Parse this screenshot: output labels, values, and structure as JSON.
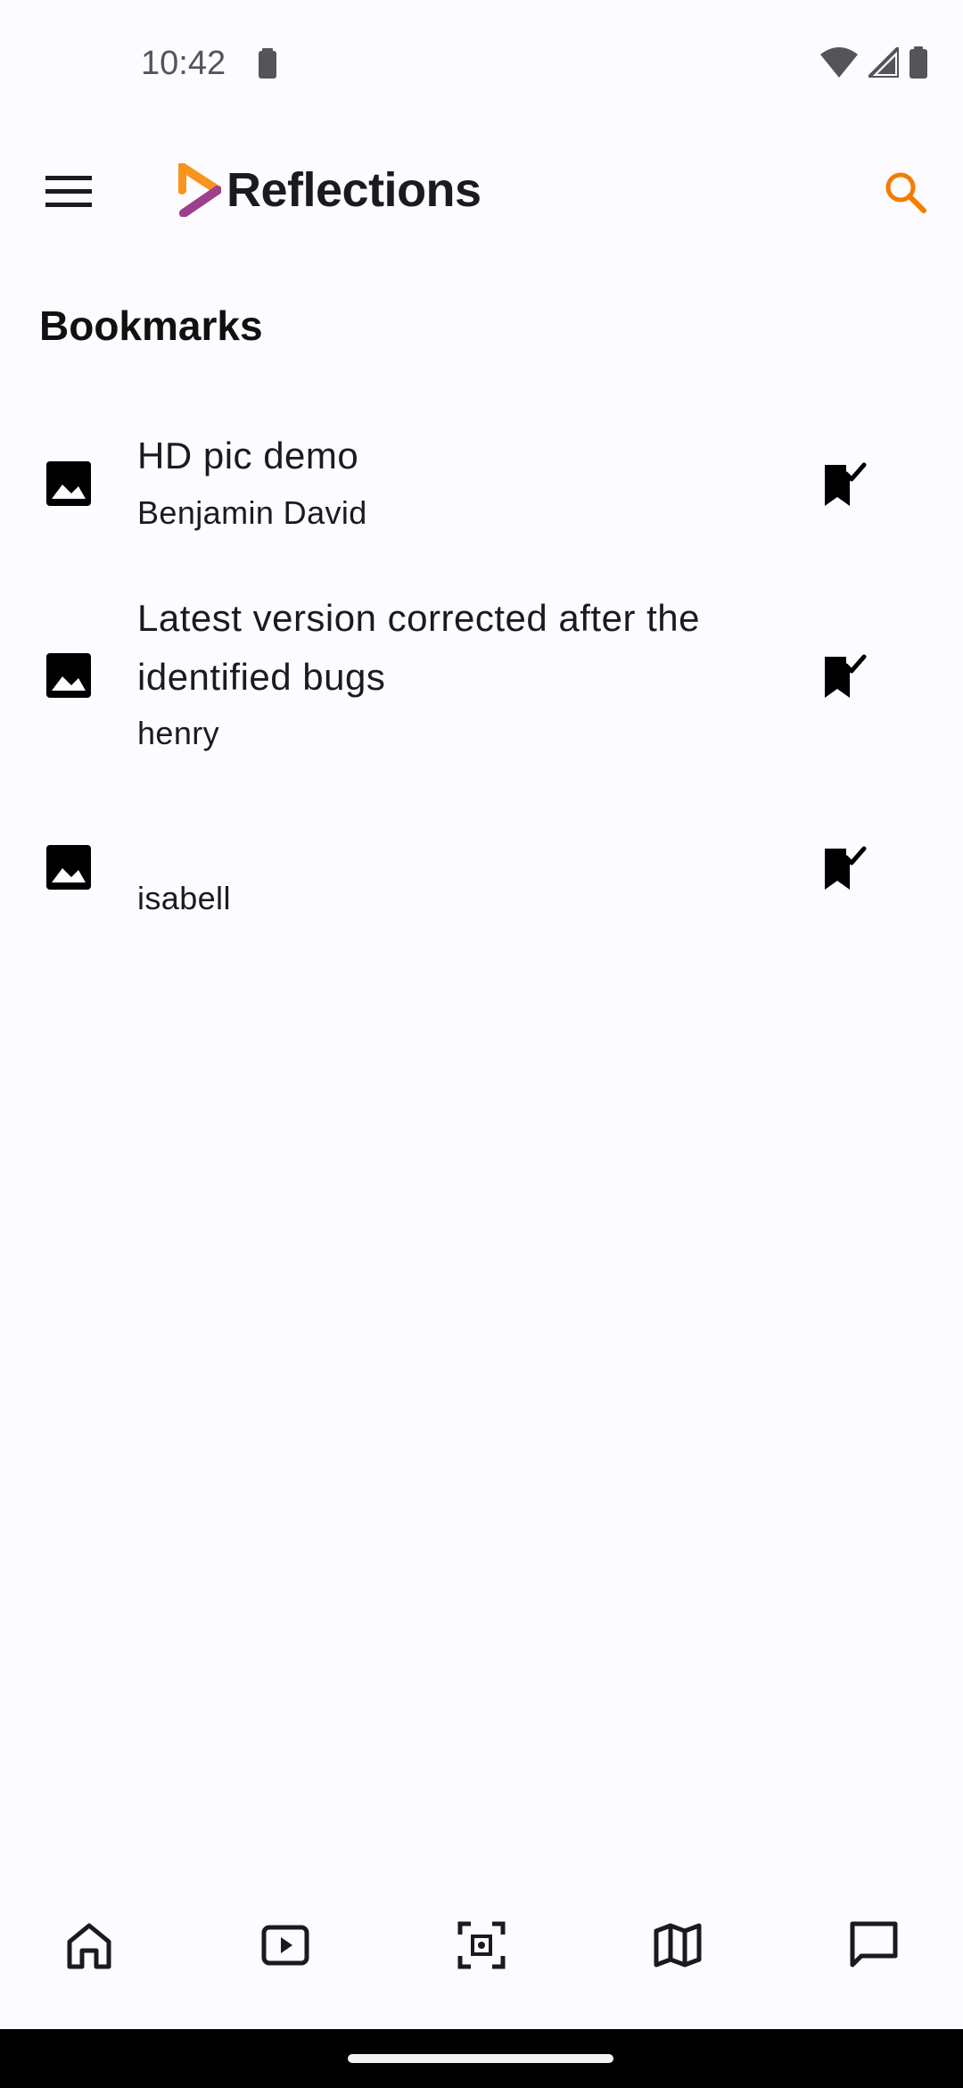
{
  "status_bar": {
    "time": "10:42"
  },
  "app_bar": {
    "title": "Reflections",
    "accent_color": "#f57c00",
    "icons": {
      "menu": "menu-icon",
      "search": "search-icon"
    }
  },
  "section": {
    "title": "Bookmarks"
  },
  "bookmarks": [
    {
      "title": "HD pic demo",
      "author": "Benjamin David",
      "type_icon": "image-icon",
      "action_icon": "bookmark-added-icon"
    },
    {
      "title": "Latest version corrected after the identified bugs",
      "author": "henry",
      "type_icon": "image-icon",
      "action_icon": "bookmark-added-icon"
    },
    {
      "title": "",
      "author": "isabell",
      "type_icon": "image-icon",
      "action_icon": "bookmark-added-icon"
    }
  ],
  "bottom_nav": {
    "items": [
      {
        "name": "home",
        "icon": "home-icon"
      },
      {
        "name": "videos",
        "icon": "play-icon"
      },
      {
        "name": "scan",
        "icon": "scan-icon"
      },
      {
        "name": "map",
        "icon": "map-icon"
      },
      {
        "name": "messages",
        "icon": "chat-icon"
      }
    ]
  }
}
